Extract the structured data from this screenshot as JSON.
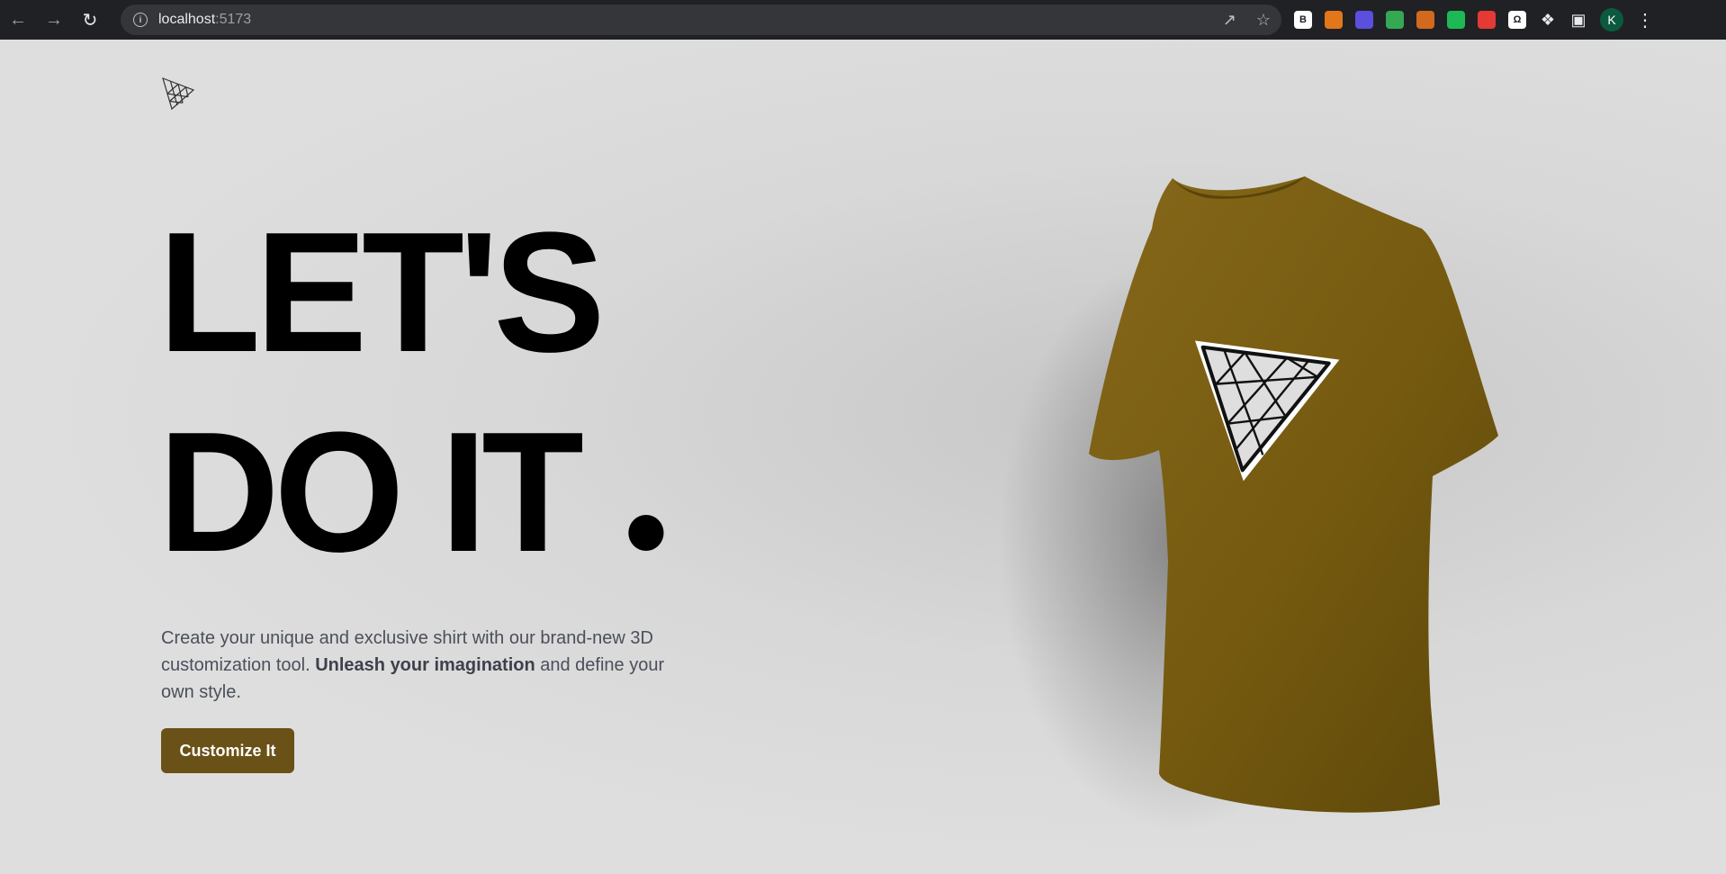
{
  "browser": {
    "url_host": "localhost",
    "url_port": ":5173",
    "extensions": [
      {
        "name": "b-extension",
        "text": "B",
        "color": "#ffffff"
      },
      {
        "name": "metamask-extension",
        "text": "",
        "color": "#e2761b"
      },
      {
        "name": "eye-extension",
        "text": "",
        "color": "#5b4fe0"
      },
      {
        "name": "robot-extension",
        "text": "",
        "color": "#34a853"
      },
      {
        "name": "cookie-extension",
        "text": "",
        "color": "#d2691e"
      },
      {
        "name": "refresh-extension",
        "text": "",
        "color": "#1db954"
      },
      {
        "name": "red-extension",
        "text": "",
        "color": "#e53935"
      },
      {
        "name": "omega-extension",
        "text": "Ω",
        "color": "#ffffff"
      }
    ],
    "profile_initial": "K"
  },
  "hero": {
    "headline_line1": "LET'S",
    "headline_line2": "DO IT",
    "description_part1": "Create your unique and exclusive shirt with our brand-new 3D customization tool. ",
    "description_bold": "Unleash your imagination",
    "description_part2": " and define your own style.",
    "cta_label": "Customize It"
  },
  "colors": {
    "accent": "#6a5117",
    "shirt": "#7a5e13",
    "background": "#dcdcdc"
  }
}
